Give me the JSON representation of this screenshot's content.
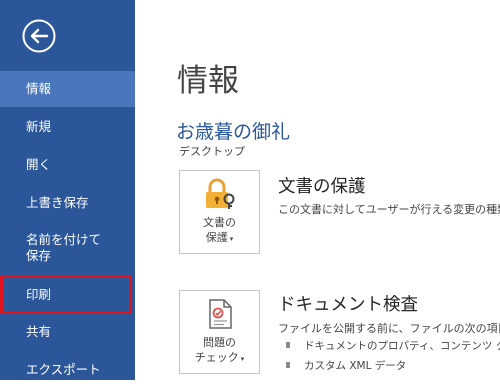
{
  "sidebar": {
    "back_icon": "back-arrow-icon",
    "colors": {
      "background": "#2b579a",
      "active": "#4a76bb",
      "highlight_border": "#e0141e"
    },
    "items": [
      {
        "label": "情報"
      },
      {
        "label": "新規"
      },
      {
        "label": "開く"
      },
      {
        "label": "上書き保存"
      },
      {
        "label_line1": "名前を付けて",
        "label_line2": "保存"
      },
      {
        "label": "印刷"
      },
      {
        "label": "共有"
      },
      {
        "label": "エクスポート"
      }
    ]
  },
  "main": {
    "page_title": "情報",
    "doc_title": "お歳暮の御礼",
    "doc_location": "デスクトップ",
    "protect": {
      "icon": "lock-key-icon",
      "button_line1": "文書の",
      "button_line2": "保護",
      "heading": "文書の保護",
      "description": "この文書に対してユーザーが行える変更の種類"
    },
    "inspect": {
      "icon": "document-check-icon",
      "button_line1": "問題の",
      "button_line2": "チェック",
      "heading": "ドキュメント検査",
      "description": "ファイルを公開する前に、ファイルの次の項目",
      "bullets": [
        "ドキュメントのプロパティ、コンテンツ タイプの",
        "カスタム XML データ"
      ]
    }
  }
}
